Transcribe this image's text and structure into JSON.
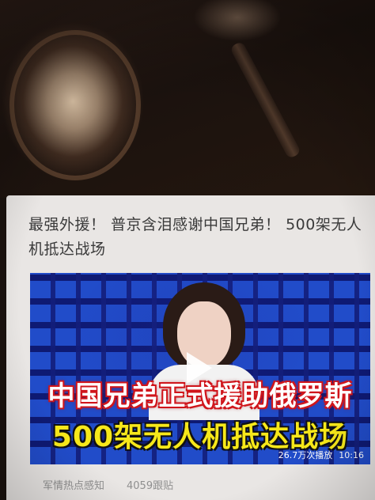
{
  "feed_card": {
    "headline": "最强外援！ 普京含泪感谢中国兄弟！ 500架无人机抵达战场",
    "video": {
      "caption_line1": "中国兄弟正式援助俄罗斯",
      "caption_line2": "500架无人机抵达战场",
      "play_count": "26.7万次播放",
      "duration": "10:16"
    },
    "source": "军情热点感知",
    "follow_count": "4059跟贴"
  },
  "colors": {
    "card_bg": "#e9e6e4",
    "headline_text": "#3a3a3a",
    "caption1_outline": "#d0151b",
    "caption2_text": "#f7e81a",
    "meta_text": "#8f8f8f"
  },
  "icons": [
    "play-icon"
  ]
}
